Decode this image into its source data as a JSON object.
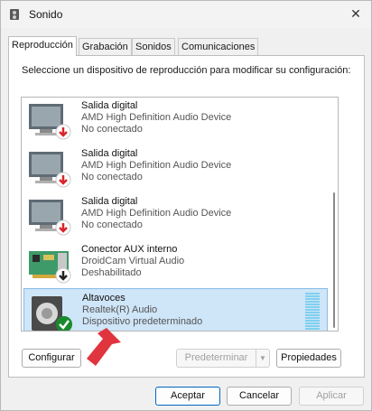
{
  "window": {
    "title": "Sonido"
  },
  "tabs": [
    {
      "label": "Reproducción"
    },
    {
      "label": "Grabación"
    },
    {
      "label": "Sonidos"
    },
    {
      "label": "Comunicaciones"
    }
  ],
  "instruction": "Seleccione un dispositivo de reproducción para modificar su configuración:",
  "devices": [
    {
      "name": "Salida digital",
      "description": "AMD High Definition Audio Device",
      "status": "No conectado",
      "icon": "monitor-icon",
      "badge": "red-down-arrow"
    },
    {
      "name": "Salida digital",
      "description": "AMD High Definition Audio Device",
      "status": "No conectado",
      "icon": "monitor-icon",
      "badge": "red-down-arrow"
    },
    {
      "name": "Salida digital",
      "description": "AMD High Definition Audio Device",
      "status": "No conectado",
      "icon": "monitor-icon",
      "badge": "red-down-arrow"
    },
    {
      "name": "Conector AUX interno",
      "description": "DroidCam Virtual Audio",
      "status": "Deshabilitado",
      "icon": "sound-card-icon",
      "badge": "black-down-arrow"
    },
    {
      "name": "Altavoces",
      "description": "Realtek(R) Audio",
      "status": "Dispositivo predeterminado",
      "icon": "speaker-icon",
      "badge": "green-check"
    }
  ],
  "buttons": {
    "configure": "Configurar",
    "set_default": "Predeterminar",
    "properties": "Propiedades",
    "ok": "Aceptar",
    "cancel": "Cancelar",
    "apply": "Aplicar"
  },
  "colors": {
    "selection": "#cfe5f8",
    "accent": "#0067c0",
    "red_badge": "#d9242a",
    "green_badge": "#1a8a2e"
  }
}
